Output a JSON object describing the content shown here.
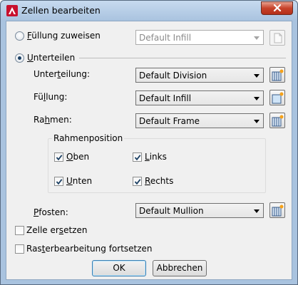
{
  "window": {
    "title": "Zellen bearbeiten"
  },
  "options": {
    "fill_radio": {
      "label": "Füllung zuweisen",
      "accel": "F",
      "rest": "üllung zuweisen",
      "selected": false,
      "value": "Default Infill"
    },
    "subdivide_radio": {
      "label": "Unterteilen",
      "accel": "U",
      "rest": "nterteilen",
      "selected": true
    }
  },
  "subdivide": {
    "division": {
      "label_pre": "Unter",
      "accel": "t",
      "label_post": "eilung:",
      "value": "Default Division"
    },
    "infill": {
      "label_pre": "Fü",
      "accel": "l",
      "label_post": "lung:",
      "value": "Default Infill"
    },
    "frame": {
      "label_pre": "Ra",
      "accel": "h",
      "label_post": "men:",
      "value": "Default Frame"
    },
    "frame_position": {
      "title": "Rahmenposition",
      "top": {
        "accel": "O",
        "rest": "ben",
        "checked": true
      },
      "left": {
        "accel": "L",
        "rest": "inks",
        "checked": true
      },
      "bottom": {
        "accel": "U",
        "rest": "nten",
        "checked": true
      },
      "right": {
        "accel": "R",
        "rest": "echts",
        "checked": true
      }
    },
    "mullion": {
      "accel": "P",
      "label_post": "fosten:",
      "value": "Default Mullion"
    }
  },
  "replace_cell": {
    "label_pre": "Zelle er",
    "accel": "s",
    "label_post": "etzen",
    "checked": false
  },
  "continue_grid": {
    "label_pre": "Ras",
    "accel": "t",
    "label_post": "erbearbeitung fortsetzen",
    "checked": false
  },
  "buttons": {
    "ok": "OK",
    "cancel": "Abbrechen"
  },
  "colors": {
    "accent": "#1b3f63",
    "close": "#c7432b",
    "title_bar": "#a9c3df"
  }
}
